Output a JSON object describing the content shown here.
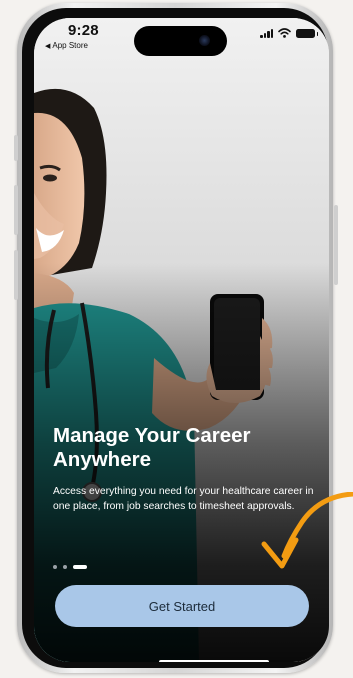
{
  "status_bar": {
    "time": "9:28",
    "back_label": "App Store"
  },
  "onboarding": {
    "headline": "Manage Your Career Anywhere",
    "description": "Access everything you need for your healthcare career in one place, from job searches to timesheet approvals.",
    "page_count": 3,
    "active_page": 3,
    "cta_label": "Get Started"
  },
  "colors": {
    "accent": "#a9c7e8",
    "scrubs": "#1f8f8b",
    "annotation_arrow": "#f39c12"
  },
  "icons": {
    "signal": "cellular-signal-icon",
    "wifi": "wifi-icon",
    "battery": "battery-icon",
    "back": "back-arrow-icon",
    "annotation": "curved-arrow-icon"
  }
}
